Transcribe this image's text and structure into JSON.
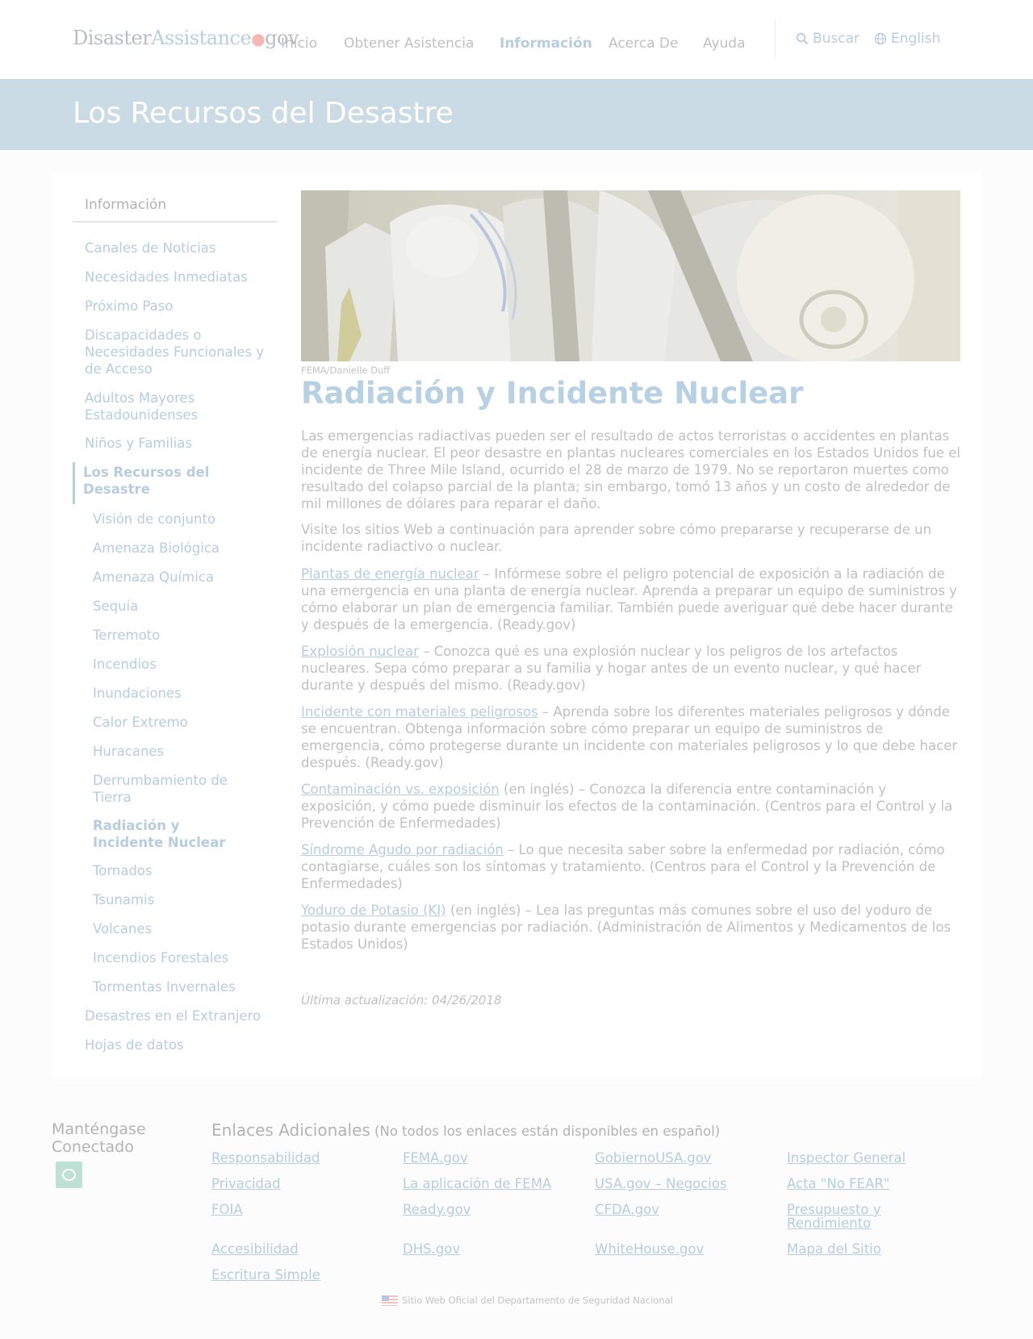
{
  "header": {
    "logo": {
      "part1": "Disaster",
      "part2": "Assistance",
      "dot": "●",
      "part3": "gov"
    },
    "nav": [
      {
        "label": "Inicio",
        "active": false
      },
      {
        "label": "Obtener Asistencia",
        "active": false
      },
      {
        "label": "Información",
        "active": true
      },
      {
        "label": "Acerca De",
        "active": false
      },
      {
        "label": "Ayuda",
        "active": false
      }
    ],
    "search_label": "Buscar",
    "language_label": "English"
  },
  "banner": {
    "title": "Los Recursos del Desastre"
  },
  "sidebar": {
    "heading": "Información",
    "items": [
      "Canales de Noticias",
      "Necesidades Inmediatas",
      "Próximo Paso",
      "Discapacidades o Necesidades Funcionales y de Acceso",
      "Adultos Mayores Estadounidenses",
      "Niños y Familias",
      "Los Recursos del Desastre"
    ],
    "subitems": [
      "Visión de conjunto",
      "Amenaza Biológica",
      "Amenaza Química",
      "Sequía",
      "Terremoto",
      "Incendios",
      "Inundaciones",
      "Calor Extremo",
      "Huracanes",
      "Derrumbamiento de Tierra",
      "Radiación y Incidente Nuclear",
      "Tornados",
      "Tsunamis",
      "Volcanes",
      "Incendios Forestales",
      "Tormentas Invernales"
    ],
    "bottom_items": [
      "Desastres en el Extranjero",
      "Hojas de datos"
    ],
    "current_section": "Los Recursos del Desastre",
    "current_page": "Radiación y Incidente Nuclear"
  },
  "content": {
    "image_credit": "FEMA/Danielle Duff",
    "title": "Radiación y Incidente Nuclear",
    "intro": "Las emergencias radiactivas pueden ser el resultado de actos terroristas o accidentes en plantas de energía nuclear. El peor desastre en plantas nucleares comerciales en los Estados Unidos fue el incidente de Three Mile Island, ocurrido el 28 de marzo de 1979. No se reportaron muertes como resultado del colapso parcial de la planta; sin embargo, tomó 13 años y un costo de alrededor de mil millones de dólares para reparar el daño.",
    "visit": "Visite los sitios Web a continuación para aprender sobre cómo prepararse y recuperarse de un incidente radiactivo o nuclear.",
    "resources": [
      {
        "link": "Plantas de energía nuclear",
        "note": "",
        "text": " – Infórmese sobre el peligro potencial de exposición a la radiación de una emergencia en una planta de energía nuclear. Aprenda a preparar un equipo de suministros y cómo elaborar un plan de emergencia familiar. También puede averiguar qué debe hacer durante y después de la emergencia. (Ready.gov)"
      },
      {
        "link": "Explosión nuclear",
        "note": "",
        "text": " – Conozca qué es una explosión nuclear y los peligros de los artefactos nucleares. Sepa cómo preparar a su familia y hogar antes de un evento nuclear, y qué hacer durante y después del mismo. (Ready.gov)"
      },
      {
        "link": "Incidente con materiales peligrosos",
        "note": "",
        "text": " – Aprenda sobre los diferentes materiales peligrosos y dónde se encuentran. Obtenga información sobre cómo preparar un equipo de suministros de emergencia, cómo protegerse durante un incidente con materiales peligrosos y lo que debe hacer después. (Ready.gov)"
      },
      {
        "link": "Contaminación vs. exposición",
        "note": " (en inglés)",
        "text": " – Conozca la diferencia entre contaminación y exposición, y cómo puede disminuir los efectos de la contaminación. (Centros para el Control y la Prevención de Enfermedades)"
      },
      {
        "link": "Síndrome Agudo por radiación",
        "note": "",
        "text": " – Lo que necesita saber sobre la enfermedad por radiación, cómo contagiarse, cuáles son los síntomas y tratamiento. (Centros para el Control y la Prevención de Enfermedades)"
      },
      {
        "link": "Yoduro de Potasio (KI)",
        "note": " (en inglés)",
        "text": " – Lea las preguntas más comunes sobre el uso del yoduro de potasio durante emergencias por radiación. (Administración de Alimentos y Medicamentos de los Estados Unidos)"
      }
    ],
    "last_updated": "Última actualización: 04/26/2018"
  },
  "footer": {
    "stay_connected": "Manténgase Conectado",
    "links_title": "Enlaces Adicionales",
    "links_note": " (No todos los enlaces están disponibles en español)",
    "links": [
      "Responsabilidad",
      "FEMA.gov",
      "GobiernoUSA.gov",
      "Inspector General",
      "Privacidad",
      "La aplicación de FEMA",
      "USA.gov – Negocios",
      "Acta \"No FEAR\"",
      "FOIA",
      "Ready.gov",
      "CFDA.gov",
      "Presupuesto y Rendimiento",
      "Accesibilidad",
      "DHS.gov",
      "WhiteHouse.gov",
      "Mapa del Sitio",
      "Escritura Simple"
    ],
    "official_site": "Sitio Web Oficial del Departamento de Seguridad Nacional"
  },
  "colors": {
    "accent": "#b6cde0",
    "banner_bg": "#cbdbe5",
    "logo_dot": "#f3b7b4",
    "rss_bg": "#bfe0d5"
  },
  "icons": {
    "search": "search-icon",
    "language": "globe-icon",
    "rss": "rss-icon",
    "flag": "us-flag-icon"
  }
}
